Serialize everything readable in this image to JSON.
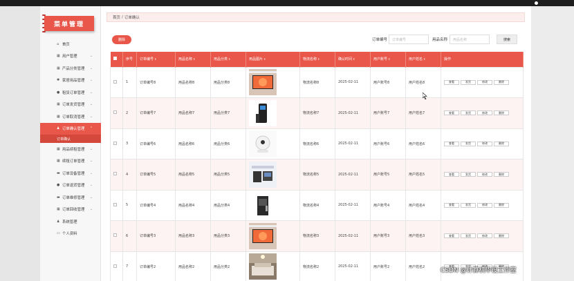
{
  "sidebar": {
    "title": "菜单管理",
    "items": [
      {
        "label": "首页",
        "icon": "home-icon"
      },
      {
        "label": "用户管理",
        "icon": "grid-icon"
      },
      {
        "label": "产品分类管理",
        "icon": "grid-icon"
      },
      {
        "label": "家居用品管理",
        "icon": "gear-icon"
      },
      {
        "label": "租赁订单管理",
        "icon": "lock-icon"
      },
      {
        "label": "订单发货管理",
        "icon": "grid-icon"
      },
      {
        "label": "订单取消管理",
        "icon": "grid-icon"
      },
      {
        "label": "订单确认管理",
        "icon": "user-icon"
      },
      {
        "label": "用品续租管理",
        "icon": "grid-icon"
      },
      {
        "label": "续租订单管理",
        "icon": "grid-icon"
      },
      {
        "label": "订单设备管理",
        "icon": "chat-icon"
      },
      {
        "label": "订单退货管理",
        "icon": "lock-icon"
      },
      {
        "label": "订单维修管理",
        "icon": "chat-icon"
      },
      {
        "label": "订单回收管理",
        "icon": "grid-icon"
      },
      {
        "label": "系统管理",
        "icon": "user-icon"
      },
      {
        "label": "个人资料",
        "icon": "doc-icon"
      }
    ],
    "active_sub": "订单确认"
  },
  "breadcrumb": {
    "home": "首页",
    "separator": "/",
    "current": "订单确认"
  },
  "toolbar": {
    "delete_label": "删除",
    "order_no_label": "订单编号",
    "order_no_placeholder": "订单编号",
    "product_name_label": "用品名称",
    "product_name_placeholder": "用品名称",
    "search_label": "搜索"
  },
  "table": {
    "headers": [
      "序号",
      "订单编号",
      "用品名称",
      "用品分类",
      "用品图片",
      "物流名称",
      "确认时间",
      "用户账号",
      "用户姓名",
      "操作"
    ],
    "op_labels": [
      "查看",
      "发货",
      "修改",
      "删除"
    ],
    "rows": [
      {
        "no": "1",
        "order_no": "订单编号8",
        "product_name": "用品名称8",
        "category": "用品分类8",
        "image": "tv-image",
        "logistics": "物流名称8",
        "time": "2025-02-11",
        "account": "用户账号8",
        "user_name": "用户姓名8"
      },
      {
        "no": "2",
        "order_no": "订单编号7",
        "product_name": "用品名称7",
        "category": "用品分类7",
        "image": "speaker-image",
        "logistics": "物流名称7",
        "time": "2025-02-11",
        "account": "用户账号7",
        "user_name": "用户姓名7"
      },
      {
        "no": "3",
        "order_no": "订单编号6",
        "product_name": "用品名称6",
        "category": "用品分类6",
        "image": "camera-image",
        "logistics": "物流名称6",
        "time": "2025-02-11",
        "account": "用户账号6",
        "user_name": "用户姓名6"
      },
      {
        "no": "4",
        "order_no": "订单编号5",
        "product_name": "用品名称5",
        "category": "用品分类5",
        "image": "devices-image",
        "logistics": "物流名称5",
        "time": "2025-02-11",
        "account": "用户账号5",
        "user_name": "用户姓名5"
      },
      {
        "no": "5",
        "order_no": "订单编号4",
        "product_name": "用品名称4",
        "category": "用品分类4",
        "image": "lock-image",
        "logistics": "物流名称4",
        "time": "2025-02-11",
        "account": "用户账号4",
        "user_name": "用户姓名4"
      },
      {
        "no": "6",
        "order_no": "订单编号3",
        "product_name": "用品名称3",
        "category": "用品分类3",
        "image": "tv-image",
        "logistics": "物流名称3",
        "time": "2025-02-11",
        "account": "用户账号3",
        "user_name": "用户姓名3"
      },
      {
        "no": "7",
        "order_no": "订单编号2",
        "product_name": "用品名称2",
        "category": "用品分类2",
        "image": "bedroom-image",
        "logistics": "物流名称2",
        "time": "2025-02-11",
        "account": "用户账号2",
        "user_name": "用户姓名2"
      }
    ]
  },
  "watermark": "CSDN @计算机毕设工作室",
  "colors": {
    "accent": "#e8574a",
    "accent_dark": "#d4483b",
    "row_alt": "#fdf3f2"
  }
}
